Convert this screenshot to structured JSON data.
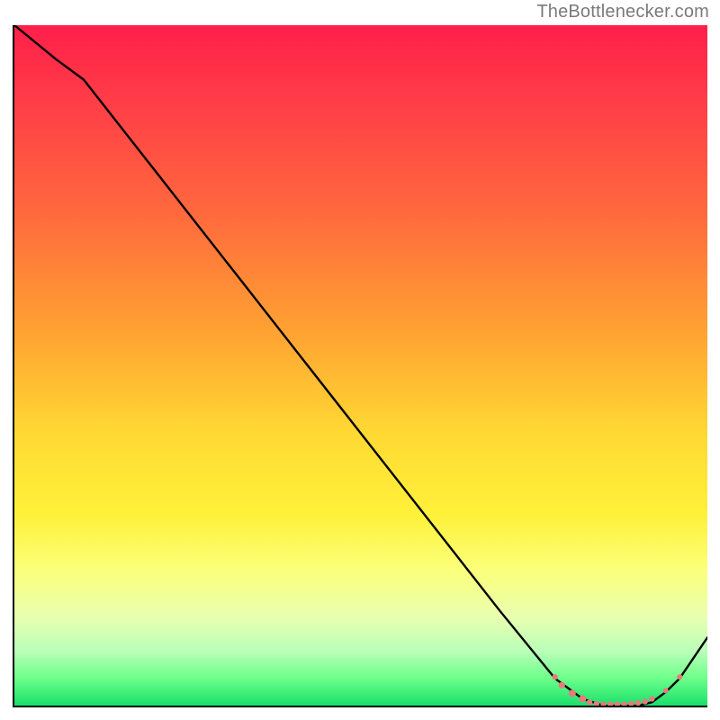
{
  "attribution": "TheBottlenecker.com",
  "chart_data": {
    "type": "line",
    "title": "",
    "xlabel": "",
    "ylabel": "",
    "xlim": [
      0,
      100
    ],
    "ylim": [
      0,
      100
    ],
    "series": [
      {
        "name": "bottleneck-curve",
        "x": [
          0,
          6,
          10,
          20,
          30,
          40,
          50,
          60,
          70,
          78,
          82,
          85,
          88,
          90,
          92,
          94,
          96,
          100
        ],
        "y": [
          100,
          95,
          92,
          79,
          66,
          53,
          40,
          27,
          14,
          4,
          1,
          0,
          0,
          0,
          0.5,
          2,
          4,
          10
        ]
      }
    ],
    "markers": {
      "name": "highlight-dots",
      "color": "#e77b7b",
      "points_x": [
        78,
        79,
        80.5,
        82,
        83,
        84,
        85,
        86,
        87,
        88,
        89,
        90,
        91,
        92,
        94,
        96
      ],
      "points_y": [
        4.2,
        3.0,
        1.8,
        1.0,
        0.5,
        0.3,
        0.2,
        0.2,
        0.2,
        0.2,
        0.3,
        0.4,
        0.6,
        1.0,
        2.2,
        4.2
      ],
      "radius": [
        3.2,
        3.6,
        4.0,
        4.0,
        3.2,
        3.2,
        3.2,
        3.2,
        3.2,
        3.2,
        3.2,
        3.2,
        3.2,
        3.2,
        3.0,
        3.0
      ]
    }
  }
}
